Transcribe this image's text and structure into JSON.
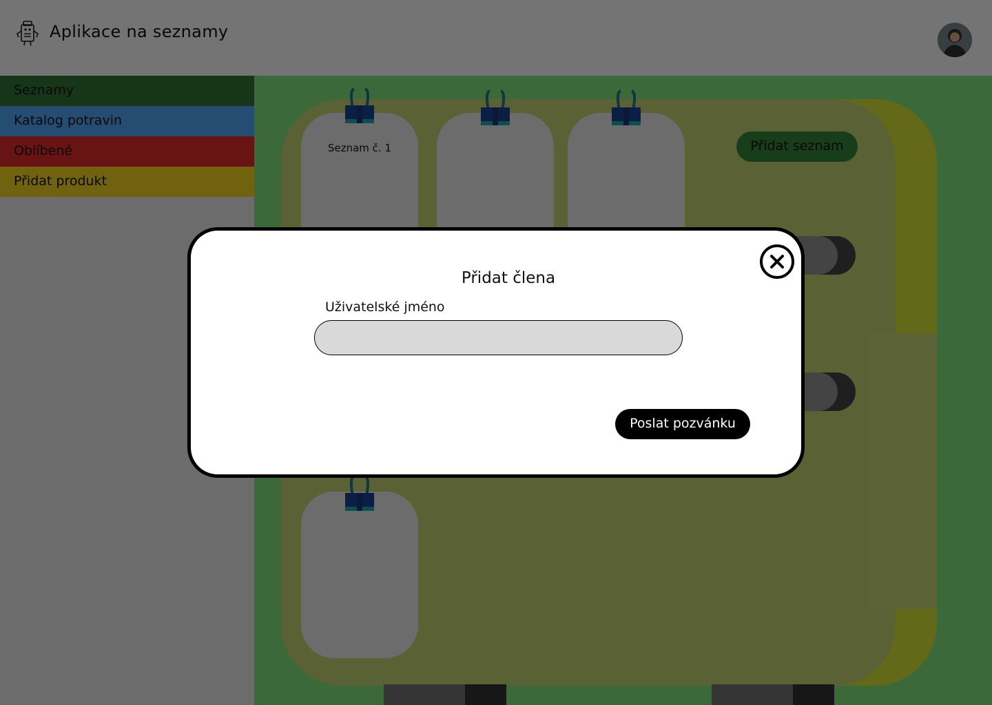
{
  "header": {
    "app_title": "Aplikace na seznamy",
    "logo_icon": "robot-list-icon",
    "avatar_icon": "user-avatar"
  },
  "sidebar": {
    "items": [
      {
        "label": "Seznamy",
        "color": "#2e6b33"
      },
      {
        "label": "Katalog potravin",
        "color": "#4a98e3"
      },
      {
        "label": "Oblíbené",
        "color": "#d1282b"
      },
      {
        "label": "Přidat produkt",
        "color": "#e1c41e"
      }
    ]
  },
  "main": {
    "add_list_label": "Přidat seznam",
    "notes": [
      {
        "label": "Seznam č. 1"
      },
      {
        "label": ""
      },
      {
        "label": ""
      },
      {
        "label": ""
      }
    ]
  },
  "modal": {
    "title": "Přidat člena",
    "field_label": "Uživatelské jméno",
    "field_value": "",
    "field_placeholder": "",
    "submit_label": "Poslat pozvánku",
    "close_icon": "close-icon"
  },
  "colors": {
    "overlay": "rgba(0,0,0,0.5)",
    "board": "#b5c56b",
    "main_bg": "#79d375",
    "clip": "#1e6f84"
  }
}
